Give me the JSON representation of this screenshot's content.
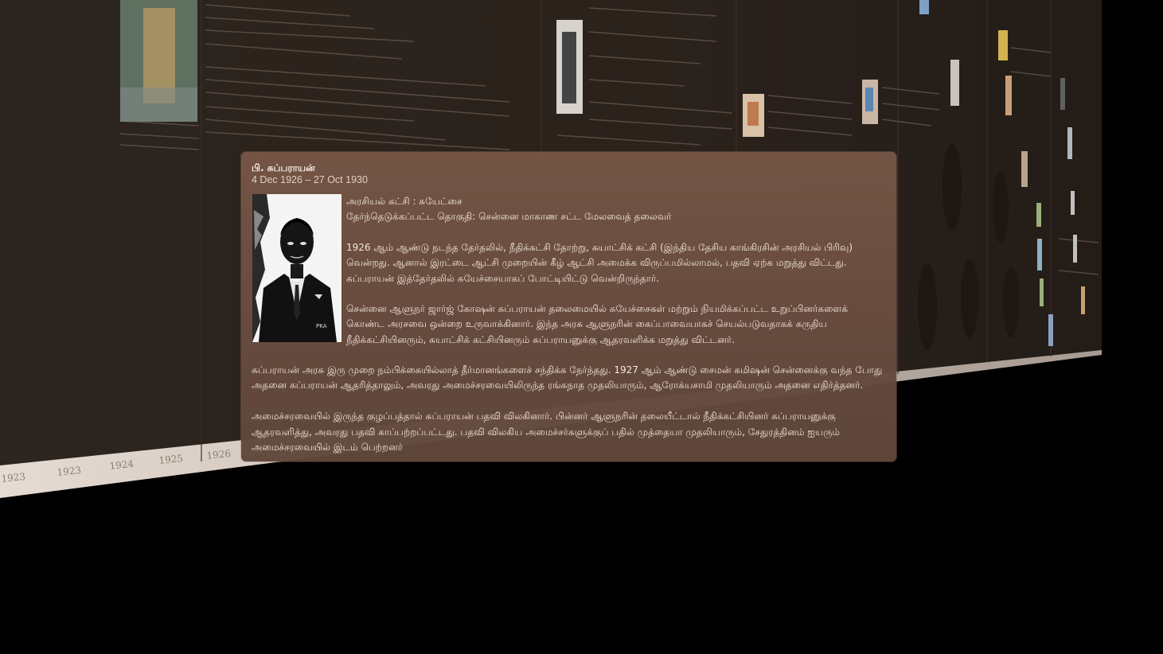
{
  "popup": {
    "title": "பி. சுப்பராயன்",
    "dates": "4 Dec 1926 – 27 Oct 1930",
    "party": "அரசியல் கட்சி : சுயேட்சை",
    "constituency": "தேர்ந்தெடுக்கப்பட்ட தொகுதி: சென்னை மாகாண சட்ட மேலவைத் தலைவர்",
    "para1": "1926 ஆம் ஆண்டு நடந்த தேர்தலில், நீதிக்கட்சி தோற்று, சுயாட்சிக் கட்சி (இந்திய தேசிய காங்கிரசின் அரசியல் பிரிவு) வென்றது. ஆனால் இரட்டை ஆட்சி முறையின் கீழ் ஆட்சி அமைக்க விருப்பமில்லாமல், பதவி ஏற்க மறுத்து விட்டது. சுப்பராயன் இத்தேர்தலில் சுயேச்சையாகப் போட்டியிட்டு வென்றிருந்தார்.",
    "para2": "சென்னை ஆளுநர் ஜார்ஜ் கோஷன் சுப்பராயன் தலைமையில் சுயேச்சைகள் மற்றும் நியமிக்கப்பட்ட உறுப்பினர்களைக் கொண்ட அரசவை ஒன்றை உருவாக்கினார். இந்த அரசு ஆளுநரின் கைப்பாவையாகச் செயல்படுவதாகக் கருதிய நீதிக்கட்சியினரும், சுயாட்சிக் கட்சியினரும் சுப்பராயனுக்கு ஆதரவளிக்க மறுத்து விட்டனர்.",
    "para3": "சுப்பராயன் அரசு இரு முறை நம்பிக்கையில்லாத் தீர்மானங்களைச் சந்திக்க நேர்ந்தது. 1927 ஆம் ஆண்டு சைமன் கமிஷன் சென்னைக்கு வந்த போது அதனை சுப்பராயன் ஆதரித்தாலும், அவரது அமைச்சரவையிலிருந்த ரங்கநாத முதலியாரும், ஆரோக்யசாமி முதலியாரும் அதனை எதிர்த்தனர்.",
    "para4": "அமைச்சரவையில் இருந்த குழப்பத்தால் சுப்பராயன் பதவி விலகினார். பின்னர் ஆளுநரின் தலையீட்டால் நீதிக்கட்சியினர் சுப்பராயனுக்கு ஆதரவளித்து, அவரது பதவி காப்பற்றப்பட்டது. பதவி விலகிய அமைச்சர்களுக்குப் பதில் முத்தையா முதலியாரும், சேதுரத்தினம் ஐயரும் அமைச்சரவையில் இடம் பெற்றனர்",
    "portrait_caption": "PKA"
  },
  "timeline": {
    "tick_labels": [
      "1923",
      "1923",
      "1924",
      "1925",
      "1926"
    ]
  },
  "colors": {
    "wall": "#2a211b",
    "popup": "#6c4f41",
    "floor": "#d8cbc2"
  }
}
